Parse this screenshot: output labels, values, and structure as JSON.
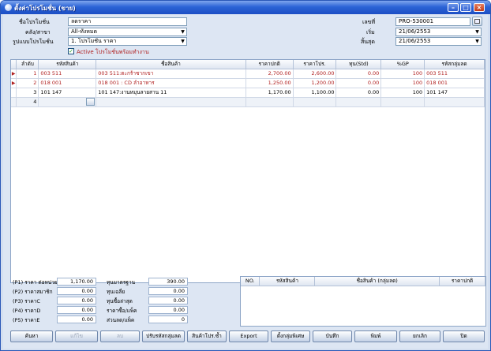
{
  "window": {
    "title": "ตั้งค่าโปรโมชั่น (ขาย)"
  },
  "form": {
    "promo_name_label": "ชื่อโปรโมชั่น",
    "promo_name_value": "ลดราคา",
    "branch_label": "คลัง/สาขา",
    "branch_value": "All-ทั้งหมด",
    "promo_type_label": "รูปแบบโปรโมชั่น",
    "promo_type_value": "1. โปรโมชั่น ราคา",
    "active_label": "Active โปรโมชั่นพร้อมทำงาน",
    "doc_no_label": "เลขที่",
    "doc_no_value": "PRO-530001",
    "start_label": "เริ่ม",
    "start_value": "21/06/2553",
    "end_label": "สิ้นสุด",
    "end_value": "21/06/2553"
  },
  "grid": {
    "columns": [
      "ลำดับ",
      "รหัสสินค้า",
      "ชื่อสินค้า",
      "ราคาปกติ",
      "ราคาโปร.",
      "ทุน(Std)",
      "%GP",
      "รหัสกลุ่มลด"
    ],
    "rows": [
      {
        "seq": "1",
        "code": "003 511",
        "name": "003 511:ตะกร้าซากเขา",
        "price": "2,700.00",
        "promo": "2,600.00",
        "cost": "0.00",
        "gp": "100",
        "group": "003 511",
        "red": true,
        "marker": "▶"
      },
      {
        "seq": "2",
        "code": "018 001",
        "name": "018 001 : CD ลำอาหาร",
        "price": "1,250.00",
        "promo": "1,200.00",
        "cost": "0.00",
        "gp": "100",
        "group": "018 001",
        "red": true,
        "marker": "▶"
      },
      {
        "seq": "3",
        "code": "101 147",
        "name": "101 147:งานหมุนลายสาน  11",
        "price": "1,170.00",
        "promo": "1,100.00",
        "cost": "0.00",
        "gp": "100",
        "group": "101 147",
        "red": false,
        "marker": ""
      },
      {
        "seq": "4",
        "code": "",
        "name": "",
        "price": "",
        "promo": "",
        "cost": "",
        "gp": "",
        "group": "",
        "red": false,
        "marker": ""
      }
    ]
  },
  "summary": {
    "p1_label": "(P1) ราคา ต่อหน่วย",
    "p1_value": "1,170.00",
    "p2_label": "(P2) ราคาสมาชิก",
    "p2_value": "0.00",
    "p3_label": "(P3) ราคาC",
    "p3_value": "0.00",
    "p4_label": "(P4) ราคาD",
    "p4_value": "0.00",
    "p5_label": "(P5) ราคาE",
    "p5_value": "0.00",
    "std_cost_label": "ทุนมาตรฐาน",
    "std_cost_value": "390.00",
    "avg_cost_label": "ทุนเฉลี่ย",
    "avg_cost_value": "0.00",
    "last_buy_label": "ทุนซื้อล่าสุด",
    "last_buy_value": "0.00",
    "buy_pack_label": "ราคาซื้อ/แพ็ค",
    "buy_pack_value": "0.00",
    "disc_pack_label": "ส่วนลด/แพ็ค",
    "disc_pack_value": "0"
  },
  "subgrid": {
    "columns": [
      "NO.",
      "รหัสสินค้า",
      "ชื่อสินค้า (กลุ่มลด)",
      "ราคาปกติ"
    ]
  },
  "buttons": {
    "search": "ค้นหา",
    "edit": "แก้ไข",
    "delete": "ลบ",
    "adjust_group": "ปรับรหัสกลุ่มลด",
    "dup_items": "สินค้าโปร.ซ้ำ",
    "export": "Export",
    "special_group": "ตั้งกลุ่มพิเศษ",
    "save": "บันทึก",
    "print": "พิมพ์",
    "cancel": "ยกเลิก",
    "close": "ปิด"
  }
}
